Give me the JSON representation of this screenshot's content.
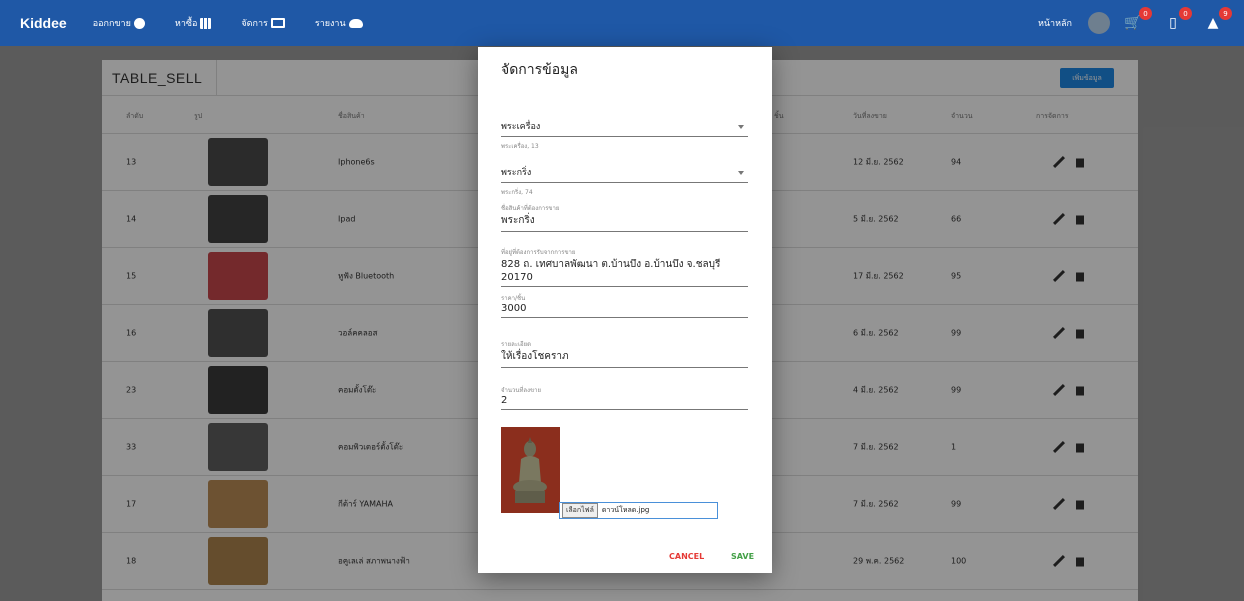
{
  "nav": {
    "brand": "Kiddee",
    "items": [
      {
        "label": "ออกกขาย",
        "icon": "dollar-icon"
      },
      {
        "label": "หาซื้อ",
        "icon": "grid-icon"
      },
      {
        "label": "จัดการ",
        "icon": "screen-icon"
      },
      {
        "label": "รายงาน",
        "icon": "cloud-icon"
      }
    ],
    "home_label": "หน้าหลัก",
    "cart_badge": "0",
    "chat_badge": "0",
    "bell_badge": "9"
  },
  "table": {
    "name": "TABLE_SELL",
    "add_label": "เพิ่มข้อมูล",
    "columns": [
      "ลำดับ",
      "รูป",
      "ชื่อสินค้า",
      "ชิ้น",
      "วันที่ลงขาย",
      "จำนวน",
      "การจัดการ"
    ],
    "rows": [
      {
        "id": "13",
        "name": "Iphone6s",
        "date": "12 มี.ย. 2562",
        "qty": "94"
      },
      {
        "id": "14",
        "name": "Ipad",
        "date": "5 มี.ย. 2562",
        "qty": "66"
      },
      {
        "id": "15",
        "name": "หูฟัง Bluetooth",
        "date": "17 มี.ย. 2562",
        "qty": "95"
      },
      {
        "id": "16",
        "name": "วอล์คคลอส",
        "date": "6 มี.ย. 2562",
        "qty": "99"
      },
      {
        "id": "23",
        "name": "คอมตั้งโต๊ะ",
        "date": "4 มี.ย. 2562",
        "qty": "99"
      },
      {
        "id": "33",
        "name": "คอมพิวเตอร์ตั้งโต๊ะ",
        "date": "7 มี.ย. 2562",
        "qty": "1"
      },
      {
        "id": "17",
        "name": "กีต้าร์ YAMAHA",
        "date": "7 มี.ย. 2562",
        "qty": "99"
      },
      {
        "id": "18",
        "name": "อคูเลเล่ สภาพนางฟ้า",
        "date": "29 พ.ค. 2562",
        "qty": "100"
      }
    ]
  },
  "dialog": {
    "title": "จัดการข้อมูล",
    "select1": {
      "value": "พระเครื่อง",
      "help": "พระเครื่อง, 13"
    },
    "select2": {
      "value": "พระกริ่ง",
      "help": "พระกริ่ง, 74"
    },
    "product": {
      "label": "ชื่อสินค้าที่ต้องการขาย",
      "value": "พระกริ่ง"
    },
    "address": {
      "label": "ที่อยู่ที่ต้องการรับจากการขาย",
      "value": "828 ถ. เทศบาลพัฒนา ต.บ้านบึง อ.บ้านบึง จ.ชลบุรี 20170"
    },
    "price": {
      "label": "ราคา/ชิ้น",
      "value": "3000"
    },
    "detail": {
      "label": "รายละเอียด",
      "value": "ให้เรื่องโชคราภ"
    },
    "amount": {
      "label": "จำนวนที่ลงขาย",
      "value": "2"
    },
    "file_button": "เลือกไฟล์",
    "file_name": "ดาวน์โหลด.jpg",
    "cancel_label": "CANCEL",
    "save_label": "SAVE"
  }
}
